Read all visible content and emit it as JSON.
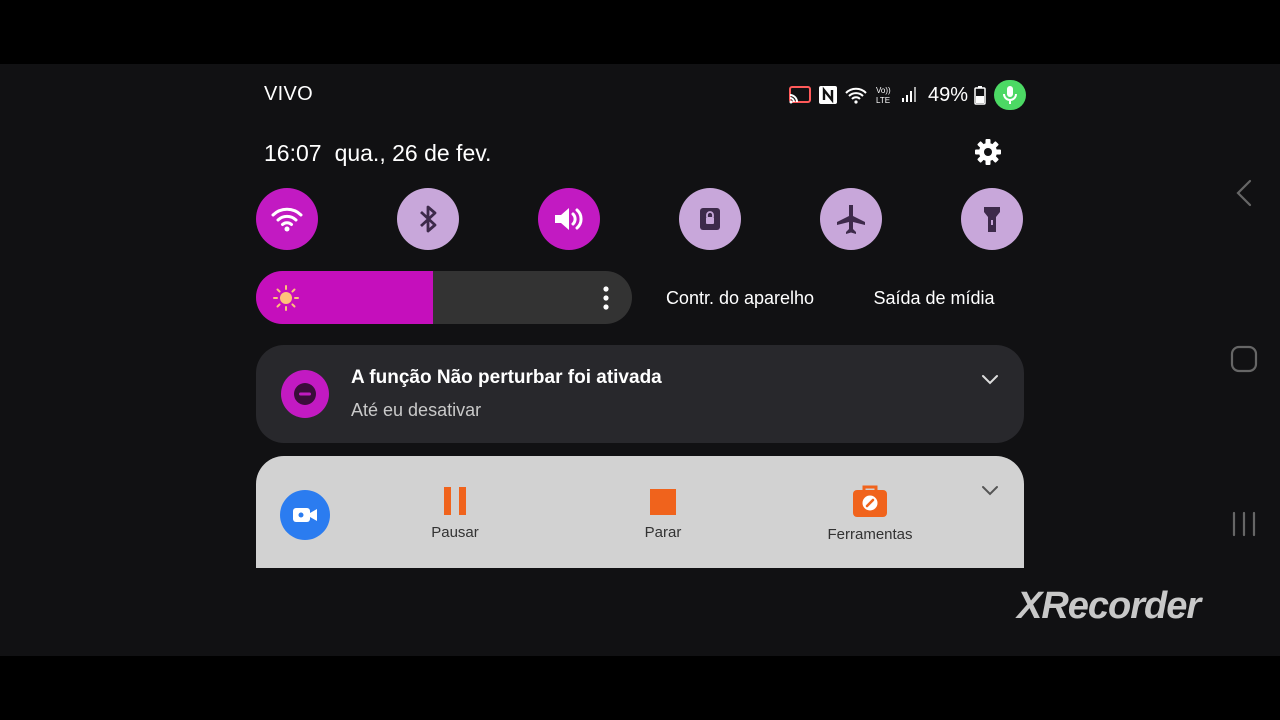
{
  "status_bar": {
    "carrier": "VIVO",
    "battery_percent": "49%",
    "icons": [
      "cast-icon",
      "nfc-icon",
      "wifi-icon",
      "volte-icon",
      "signal-icon",
      "battery-icon",
      "mic-icon"
    ],
    "volte_label": "Vo)\nLTE"
  },
  "header": {
    "time": "16:07",
    "date": "qua., 26 de fev."
  },
  "quick_toggles": [
    {
      "name": "wifi",
      "icon": "wifi-icon",
      "state": "on"
    },
    {
      "name": "bluetooth",
      "icon": "bluetooth-icon",
      "state": "off"
    },
    {
      "name": "sound",
      "icon": "volume-icon",
      "state": "on"
    },
    {
      "name": "rotation-lock",
      "icon": "lock-icon",
      "state": "off"
    },
    {
      "name": "airplane-mode",
      "icon": "airplane-icon",
      "state": "off"
    },
    {
      "name": "flashlight",
      "icon": "flashlight-icon",
      "state": "off"
    }
  ],
  "brightness": {
    "level": 0.47
  },
  "controls": {
    "device_control_label": "Contr. do aparelho",
    "media_output_label": "Saída de mídia"
  },
  "dnd_notification": {
    "title": "A função Não perturbar foi ativada",
    "subtitle": "Até eu desativar"
  },
  "recorder_notification": {
    "pause_label": "Pausar",
    "stop_label": "Parar",
    "tools_label": "Ferramentas"
  },
  "watermark": "XRecorder",
  "colors": {
    "accent": "#c21ac2",
    "toggle_off": "#c8a7da",
    "recorder_orange": "#f0631c",
    "recorder_blue": "#2b7cf0",
    "mic_green": "#4cd964"
  }
}
